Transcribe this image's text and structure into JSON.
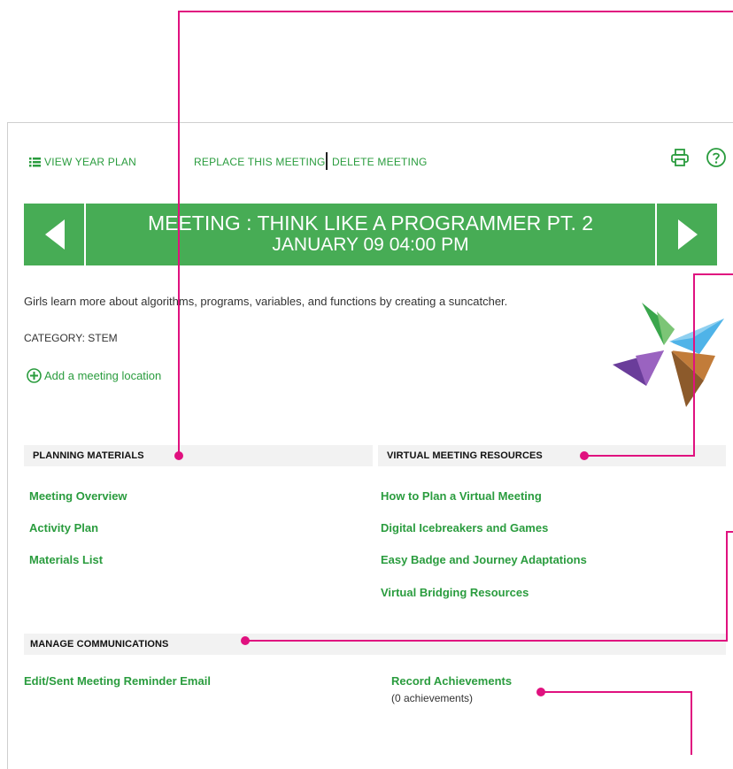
{
  "toolbar": {
    "view_year_plan": "VIEW YEAR PLAN",
    "replace_meeting": "REPLACE THIS MEETING",
    "delete_meeting": "DELETE MEETING",
    "print_icon": "printer-icon",
    "help_icon": "help-icon"
  },
  "banner": {
    "title": "MEETING : THINK LIKE A PROGRAMMER PT. 2",
    "datetime": "JANUARY 09 04:00 PM"
  },
  "meeting": {
    "description": "Girls learn more about algorithms, programs, variables, and functions by creating a suncatcher.",
    "category": "CATEGORY: STEM",
    "add_location": "Add a meeting location"
  },
  "planning": {
    "header": "PLANNING MATERIALS",
    "links": [
      "Meeting Overview",
      "Activity Plan",
      "Materials List"
    ]
  },
  "virtual": {
    "header": "VIRTUAL MEETING RESOURCES",
    "links": [
      "How to Plan a Virtual Meeting",
      "Digital Icebreakers and Games",
      "Easy Badge and Journey Adaptations",
      "Virtual Bridging Resources"
    ]
  },
  "communications": {
    "header": "MANAGE COMMUNICATIONS",
    "reminder_email": "Edit/Sent Meeting Reminder Email",
    "record_achievements": "Record Achievements",
    "achievements_count": "(0 achievements)"
  },
  "colors": {
    "accent_green": "#2a9c3e",
    "banner_green": "#47ac55",
    "callout_magenta": "#e0117f"
  }
}
